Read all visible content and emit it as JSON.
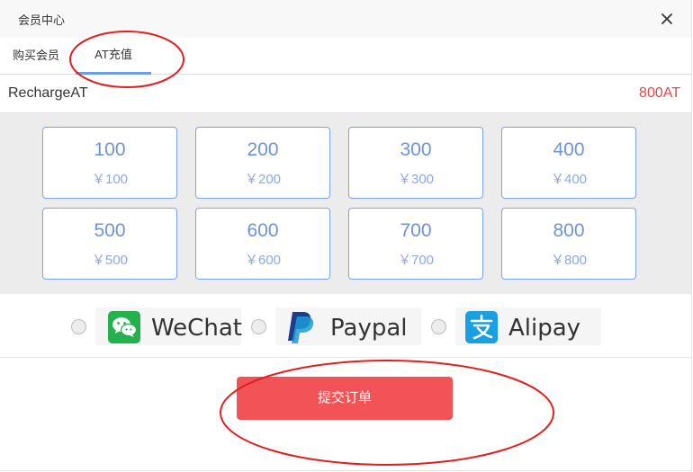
{
  "dialog": {
    "title": "会员中心",
    "close_icon": "close-icon"
  },
  "tabs": [
    {
      "label": "购买会员",
      "active": false
    },
    {
      "label": "AT充值",
      "active": true
    }
  ],
  "balance": {
    "label": "RechargeAT",
    "value": "800AT"
  },
  "packages": [
    {
      "amount": "100",
      "price": "￥100"
    },
    {
      "amount": "200",
      "price": "￥200"
    },
    {
      "amount": "300",
      "price": "￥300"
    },
    {
      "amount": "400",
      "price": "￥400"
    },
    {
      "amount": "500",
      "price": "￥500"
    },
    {
      "amount": "600",
      "price": "￥600"
    },
    {
      "amount": "700",
      "price": "￥700"
    },
    {
      "amount": "800",
      "price": "￥800"
    }
  ],
  "payment_methods": [
    {
      "label": "WeChat",
      "icon": "wechat-icon",
      "color": "#22b14c"
    },
    {
      "label": "Paypal",
      "icon": "paypal-icon",
      "color": "#1f3b8c"
    },
    {
      "label": "Alipay",
      "icon": "alipay-icon",
      "color": "#1a9fe3"
    }
  ],
  "submit": {
    "label": "提交订单"
  },
  "colors": {
    "accent": "#6b9de8",
    "submit": "#f25357",
    "balance": "#e04848",
    "annotation": "#e02020"
  }
}
